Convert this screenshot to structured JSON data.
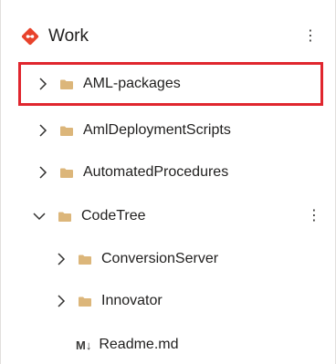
{
  "repo": {
    "title": "Work",
    "icon": "git-repo-icon",
    "brand_color": "#e8432c"
  },
  "tree": [
    {
      "label": "AML-packages",
      "type": "folder",
      "expanded": false,
      "level": 0,
      "highlighted": true
    },
    {
      "label": "AmlDeploymentScripts",
      "type": "folder",
      "expanded": false,
      "level": 0
    },
    {
      "label": "AutomatedProcedures",
      "type": "folder",
      "expanded": false,
      "level": 0
    },
    {
      "label": "CodeTree",
      "type": "folder",
      "expanded": true,
      "level": 0,
      "has_menu": true
    },
    {
      "label": "ConversionServer",
      "type": "folder",
      "expanded": false,
      "level": 1
    },
    {
      "label": "Innovator",
      "type": "folder",
      "expanded": false,
      "level": 1
    },
    {
      "label": "Readme.md",
      "type": "file",
      "icon_text": "M↓",
      "level": 1
    }
  ],
  "colors": {
    "folder": "#dcb67a",
    "highlight_border": "#e0262e"
  }
}
